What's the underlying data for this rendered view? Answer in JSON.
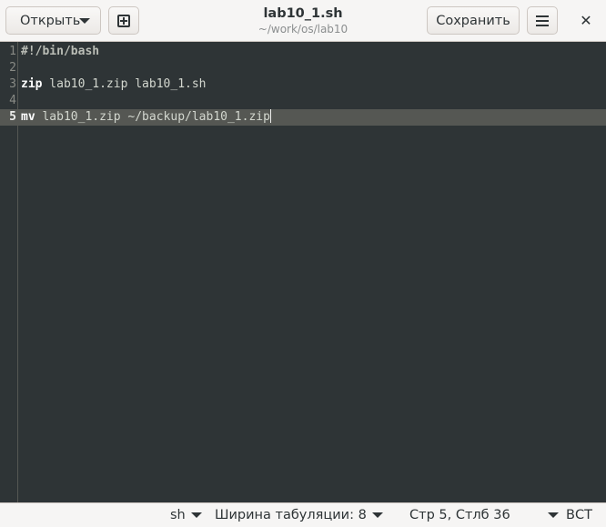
{
  "header": {
    "open_label": "Открыть",
    "title": "lab10_1.sh",
    "subtitle": "~/work/os/lab10",
    "save_label": "Сохранить",
    "close_glyph": "✕"
  },
  "editor": {
    "lines": [
      {
        "num": "1",
        "parts": [
          {
            "cls": "comment",
            "text": "#!/bin/bash"
          }
        ]
      },
      {
        "num": "2",
        "parts": []
      },
      {
        "num": "3",
        "parts": [
          {
            "cls": "kw",
            "text": "zip"
          },
          {
            "cls": "",
            "text": " lab10_1.zip lab10_1.sh"
          }
        ]
      },
      {
        "num": "4",
        "parts": []
      },
      {
        "num": "5",
        "parts": [
          {
            "cls": "kw",
            "text": "mv"
          },
          {
            "cls": "",
            "text": " lab10_1.zip ~/backup/lab10_1.zip"
          }
        ],
        "current": true
      }
    ]
  },
  "statusbar": {
    "language": "sh",
    "tab_width": "Ширина табуляции: 8",
    "position": "Стр 5, Стлб 36",
    "insert_mode": "ВСТ"
  }
}
